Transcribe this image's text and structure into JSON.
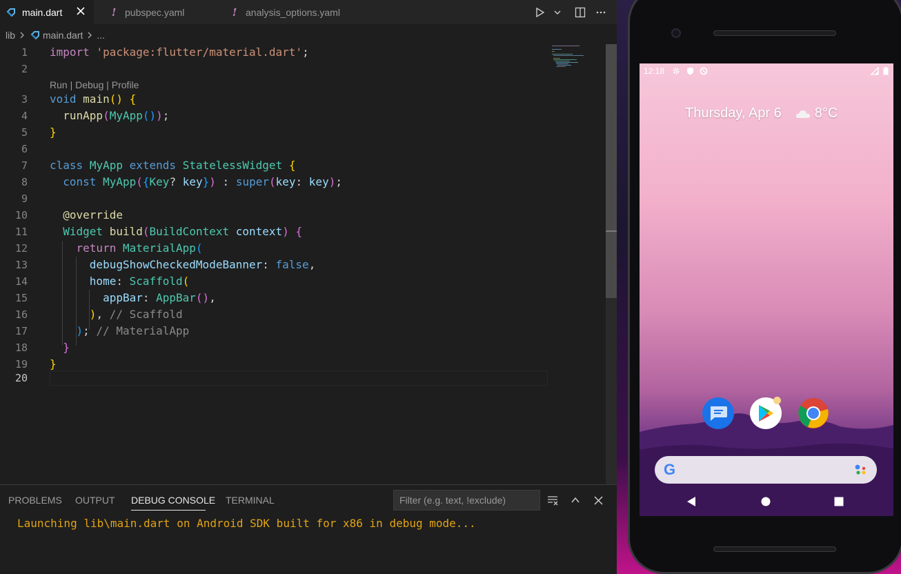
{
  "tabs": [
    {
      "label": "main.dart",
      "active": true,
      "icon": "dart-icon"
    },
    {
      "label": "pubspec.yaml",
      "active": false,
      "icon": "yaml-exclamation-icon"
    },
    {
      "label": "analysis_options.yaml",
      "active": false,
      "icon": "yaml-exclamation-icon"
    }
  ],
  "tab_icon_glyph": "!",
  "breadcrumb": {
    "folder": "lib",
    "file": "main.dart",
    "more": "..."
  },
  "codelens": "Run | Debug | Profile",
  "line_numbers": [
    "1",
    "2",
    "3",
    "4",
    "5",
    "6",
    "7",
    "8",
    "9",
    "10",
    "11",
    "12",
    "13",
    "14",
    "15",
    "16",
    "17",
    "18",
    "19",
    "20"
  ],
  "code": {
    "l1": {
      "kw": "import",
      "str": "'package:flutter/material.dart'",
      "end": ";"
    },
    "l3": {
      "kw": "void",
      "fn": "main",
      "p": "()",
      "b": "{"
    },
    "l4": {
      "fn": "runApp",
      "o": "(",
      "ty": "MyApp",
      "i": "()",
      "c": ")",
      "end": ";"
    },
    "l5": {
      "b": "}"
    },
    "l7": {
      "kw": "class",
      "ty1": "MyApp",
      "kw2": "extends",
      "ty2": "StatelessWidget",
      "b": "{"
    },
    "l8": {
      "kw": "const",
      "ty": "MyApp",
      "o": "(",
      "ob": "{",
      "ty2": "Key",
      "q": "?",
      "var": "key",
      "cb": "}",
      "c": ")",
      "colon": " : ",
      "kw2": "super",
      "o2": "(",
      "var2": "key",
      "sep": ": ",
      "var3": "key",
      "c2": ")",
      "end": ";"
    },
    "l10": {
      "ann": "@override"
    },
    "l11": {
      "ty": "Widget",
      "fn": "build",
      "o": "(",
      "ty2": "BuildContext",
      "var": "context",
      "c": ")",
      "b": "{"
    },
    "l12": {
      "kw": "return",
      "ty": "MaterialApp",
      "o": "("
    },
    "l13": {
      "var": "debugShowCheckedModeBanner",
      "sep": ": ",
      "kw": "false",
      "end": ","
    },
    "l14": {
      "var": "home",
      "sep": ": ",
      "ty": "Scaffold",
      "o": "("
    },
    "l15": {
      "var": "appBar",
      "sep": ": ",
      "ty": "AppBar",
      "p": "()",
      "end": ","
    },
    "l16": {
      "c": ")",
      "end": ",",
      "cm": "// Scaffold"
    },
    "l17": {
      "c": ")",
      "end": ";",
      "cm": "// MaterialApp"
    },
    "l18": {
      "b": "}"
    },
    "l19": {
      "b": "}"
    }
  },
  "panel": {
    "tabs": [
      "PROBLEMS",
      "OUTPUT",
      "DEBUG CONSOLE",
      "TERMINAL"
    ],
    "active_tab": "DEBUG CONSOLE",
    "filter_placeholder": "Filter (e.g. text, !exclude)",
    "console_output": "Launching lib\\main.dart on Android SDK built for x86 in debug mode..."
  },
  "emulator": {
    "time": "12:18",
    "date": "Thursday, Apr 6",
    "temperature": "8°C",
    "apps": [
      "messages-icon",
      "play-store-icon",
      "chrome-icon"
    ],
    "search_logo": "G"
  },
  "colors": {
    "editor_bg": "#1e1e1e",
    "keyword": "#569cd6",
    "control": "#c586c0",
    "string": "#ce9178",
    "function": "#dcdcaa",
    "type": "#4ec9b0",
    "variable": "#9cdcfe",
    "console_text": "#e2a414"
  }
}
